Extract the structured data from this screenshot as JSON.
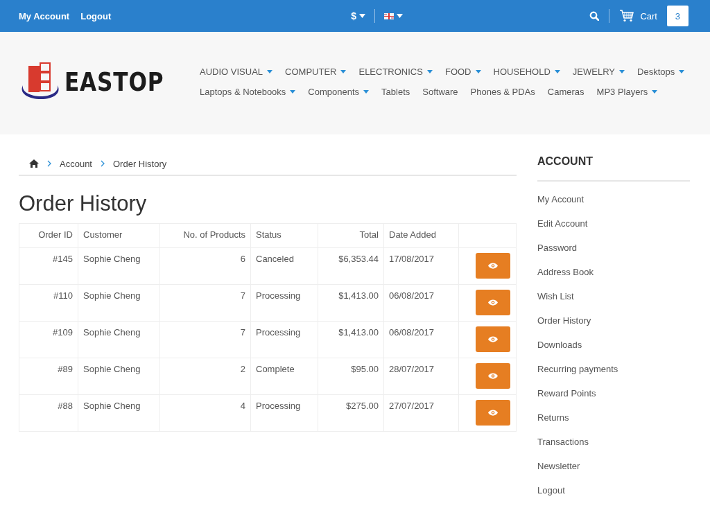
{
  "top_bar": {
    "links": [
      "My Account",
      "Logout"
    ],
    "currency": "$",
    "cart": {
      "label": "Cart",
      "count": "3"
    }
  },
  "logo": {
    "text": "EASTOP"
  },
  "menu": [
    {
      "label": "AUDIO VISUAL",
      "dropdown": true
    },
    {
      "label": "COMPUTER",
      "dropdown": true
    },
    {
      "label": "ELECTRONICS",
      "dropdown": true
    },
    {
      "label": "FOOD",
      "dropdown": true
    },
    {
      "label": "HOUSEHOLD",
      "dropdown": true
    },
    {
      "label": "JEWELRY",
      "dropdown": true
    },
    {
      "label": "Desktops",
      "dropdown": true
    },
    {
      "label": "Laptops & Notebooks",
      "dropdown": true
    },
    {
      "label": "Components",
      "dropdown": true
    },
    {
      "label": "Tablets",
      "dropdown": false
    },
    {
      "label": "Software",
      "dropdown": false
    },
    {
      "label": "Phones & PDAs",
      "dropdown": false
    },
    {
      "label": "Cameras",
      "dropdown": false
    },
    {
      "label": "MP3 Players",
      "dropdown": true
    }
  ],
  "breadcrumb": [
    "Account",
    "Order History"
  ],
  "page_title": "Order History",
  "table": {
    "columns": [
      "Order ID",
      "Customer",
      "No. of Products",
      "Status",
      "Total",
      "Date Added"
    ],
    "rows": [
      {
        "cells": [
          "#145",
          "Sophie Cheng",
          "6",
          "Canceled",
          "$6,353.44",
          "17/08/2017"
        ]
      },
      {
        "cells": [
          "#110",
          "Sophie Cheng",
          "7",
          "Processing",
          "$1,413.00",
          "06/08/2017"
        ]
      },
      {
        "cells": [
          "#109",
          "Sophie Cheng",
          "7",
          "Processing",
          "$1,413.00",
          "06/08/2017"
        ]
      },
      {
        "cells": [
          "#89",
          "Sophie Cheng",
          "2",
          "Complete",
          "$95.00",
          "28/07/2017"
        ]
      },
      {
        "cells": [
          "#88",
          "Sophie Cheng",
          "4",
          "Processing",
          "$275.00",
          "27/07/2017"
        ]
      }
    ]
  },
  "sidebar": {
    "title": "ACCOUNT",
    "items": [
      "My Account",
      "Edit Account",
      "Password",
      "Address Book",
      "Wish List",
      "Order History",
      "Downloads",
      "Recurring payments",
      "Reward Points",
      "Returns",
      "Transactions",
      "Newsletter",
      "Logout"
    ]
  }
}
